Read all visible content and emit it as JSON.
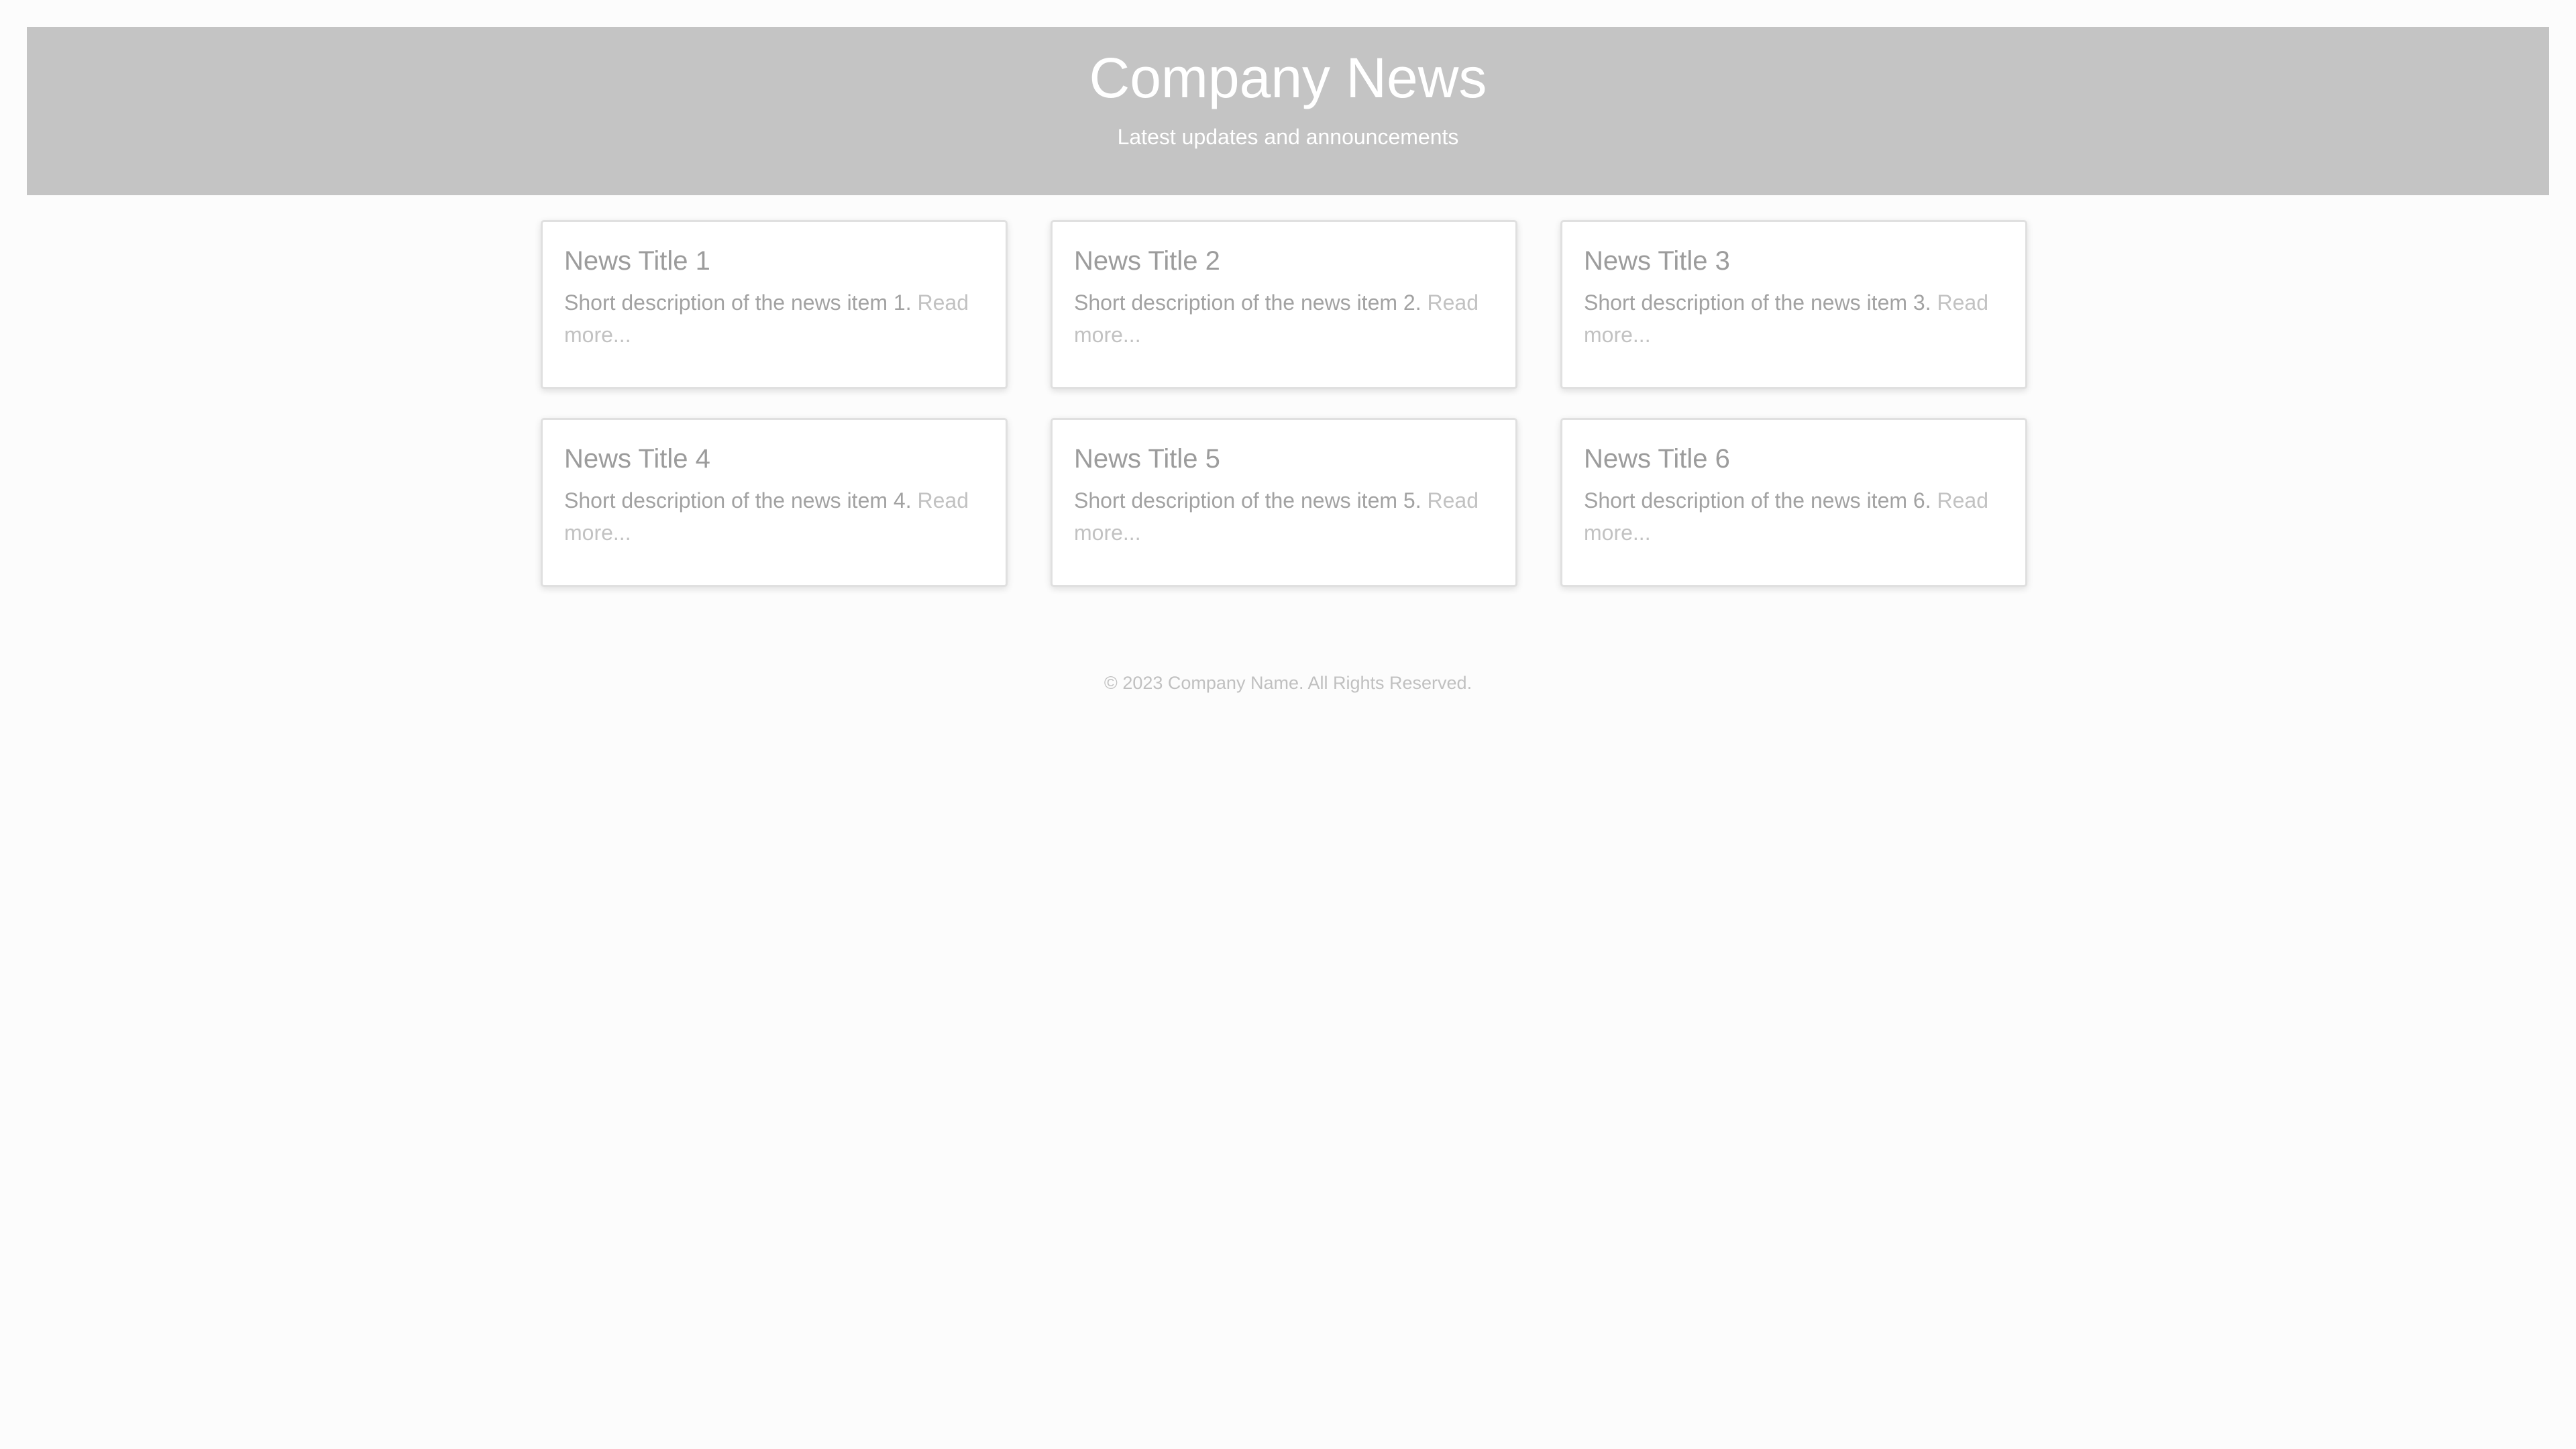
{
  "header": {
    "title": "Company News",
    "subtitle": "Latest updates and announcements"
  },
  "news": [
    {
      "title": "News Title 1",
      "description": "Short description of the news item 1.",
      "link": "Read more..."
    },
    {
      "title": "News Title 2",
      "description": "Short description of the news item 2.",
      "link": "Read more..."
    },
    {
      "title": "News Title 3",
      "description": "Short description of the news item 3.",
      "link": "Read more..."
    },
    {
      "title": "News Title 4",
      "description": "Short description of the news item 4.",
      "link": "Read more..."
    },
    {
      "title": "News Title 5",
      "description": "Short description of the news item 5.",
      "link": "Read more..."
    },
    {
      "title": "News Title 6",
      "description": "Short description of the news item 6.",
      "link": "Read more..."
    }
  ],
  "footer": {
    "text": "© 2023 Company Name. All Rights Reserved."
  },
  "colors": {
    "header_background": "#c4c4c4",
    "header_text": "#ffffff",
    "page_background": "#fcfcfc",
    "card_background": "#ffffff"
  }
}
